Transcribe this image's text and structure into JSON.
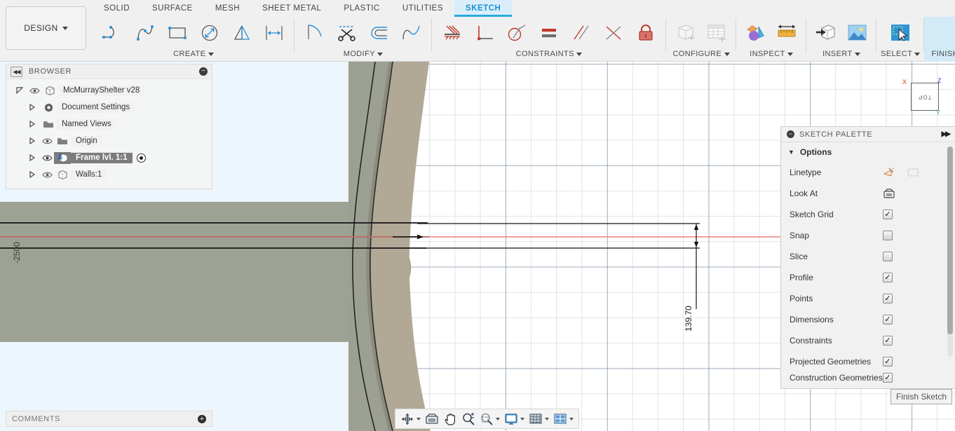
{
  "app": {
    "product_menu": "DESIGN"
  },
  "tabs": [
    {
      "label": "SOLID",
      "active": false
    },
    {
      "label": "SURFACE",
      "active": false
    },
    {
      "label": "MESH",
      "active": false
    },
    {
      "label": "SHEET METAL",
      "active": false
    },
    {
      "label": "PLASTIC",
      "active": false
    },
    {
      "label": "UTILITIES",
      "active": false
    },
    {
      "label": "SKETCH",
      "active": true
    }
  ],
  "ribbon": {
    "groups": [
      {
        "label": "CREATE",
        "tools": [
          {
            "icon": "line-icon",
            "name": "line-tool"
          },
          {
            "icon": "spline-icon",
            "name": "spline-tool"
          },
          {
            "icon": "rectangle-icon",
            "name": "rectangle-tool"
          },
          {
            "icon": "circle-icon",
            "name": "circle-tool"
          },
          {
            "icon": "mirror-icon",
            "name": "mirror-tool"
          },
          {
            "icon": "sketch-dimension-icon",
            "name": "sketch-dimension-tool"
          }
        ]
      },
      {
        "label": "MODIFY",
        "tools": [
          {
            "icon": "fillet-icon",
            "name": "fillet-tool"
          },
          {
            "icon": "trim-scissors-icon",
            "name": "trim-tool"
          },
          {
            "icon": "offset-icon",
            "name": "offset-tool"
          },
          {
            "icon": "break-curve-icon",
            "name": "break-tool"
          }
        ]
      },
      {
        "label": "CONSTRAINTS",
        "tools": [
          {
            "icon": "coincident-icon",
            "name": "coincident-constraint"
          },
          {
            "icon": "perpendicular-icon",
            "name": "perpendicular-constraint"
          },
          {
            "icon": "tangent-icon",
            "name": "tangent-constraint"
          },
          {
            "icon": "equal-icon",
            "name": "equal-constraint"
          },
          {
            "icon": "parallel-icon",
            "name": "parallel-constraint"
          },
          {
            "icon": "midpoint-icon",
            "name": "midpoint-constraint"
          },
          {
            "icon": "fix-unfix-lock-icon",
            "name": "fix-unfix-constraint"
          }
        ]
      },
      {
        "label": "CONFIGURE",
        "tools": [
          {
            "icon": "configure-part-icon",
            "name": "configure-part-tool"
          },
          {
            "icon": "configure-table-icon",
            "name": "configure-table-tool"
          }
        ]
      },
      {
        "label": "INSPECT",
        "tools": [
          {
            "icon": "section-analysis-icon",
            "name": "section-analysis-tool"
          },
          {
            "icon": "measure-ruler-icon",
            "name": "measure-tool"
          }
        ]
      },
      {
        "label": "INSERT",
        "tools": [
          {
            "icon": "insert-derive-icon",
            "name": "insert-derive-tool"
          },
          {
            "icon": "insert-canvas-image-icon",
            "name": "insert-canvas-tool"
          }
        ]
      },
      {
        "label": "SELECT",
        "tools": [
          {
            "icon": "select-cursor-icon",
            "name": "select-tool"
          }
        ]
      },
      {
        "label": "FINISH SKETCH",
        "tools": [
          {
            "icon": "green-check-icon",
            "name": "finish-sketch-tool"
          }
        ]
      }
    ]
  },
  "browser": {
    "title": "BROWSER",
    "nodes": [
      {
        "label": "McMurrayShelter v28",
        "icon": "document-body-icon",
        "expanded": true,
        "eye": true,
        "arrow": "open",
        "selected": false,
        "radio": false
      },
      {
        "label": "Document Settings",
        "icon": "gear-icon",
        "expanded": false,
        "eye": false,
        "arrow": "closed",
        "selected": false,
        "radio": false
      },
      {
        "label": "Named Views",
        "icon": "folder-icon",
        "expanded": false,
        "eye": false,
        "arrow": "closed",
        "selected": false,
        "radio": false
      },
      {
        "label": "Origin",
        "icon": "folder-icon",
        "expanded": false,
        "eye": true,
        "arrow": "closed",
        "selected": false,
        "radio": false
      },
      {
        "label": "Frame lvl. 1:1",
        "icon": "component-anchor-icon",
        "expanded": false,
        "eye": true,
        "arrow": "closed",
        "selected": true,
        "radio": true
      },
      {
        "label": "Walls:1",
        "icon": "component-icon",
        "expanded": false,
        "eye": true,
        "arrow": "closed",
        "selected": false,
        "radio": false
      }
    ]
  },
  "comments": {
    "title": "COMMENTS",
    "add_icon": "plus-icon"
  },
  "palette": {
    "title": "SKETCH PALETTE",
    "section": "Options",
    "rows": [
      {
        "label": "Linetype",
        "control": "icon-pair",
        "icons": [
          "linetype-normal-icon",
          "linetype-construction-icon"
        ]
      },
      {
        "label": "Look At",
        "control": "icon",
        "icons": [
          "look-at-icon"
        ]
      },
      {
        "label": "Sketch Grid",
        "control": "checkbox",
        "checked": true
      },
      {
        "label": "Snap",
        "control": "checkbox",
        "checked": false
      },
      {
        "label": "Slice",
        "control": "checkbox",
        "checked": false
      },
      {
        "label": "Profile",
        "control": "checkbox",
        "checked": true
      },
      {
        "label": "Points",
        "control": "checkbox",
        "checked": true
      },
      {
        "label": "Dimensions",
        "control": "checkbox",
        "checked": true
      },
      {
        "label": "Constraints",
        "control": "checkbox",
        "checked": true
      },
      {
        "label": "Projected Geometries",
        "control": "checkbox",
        "checked": true
      },
      {
        "label": "Construction Geometries",
        "control": "checkbox",
        "checked": true
      }
    ],
    "finish_button": "Finish Sketch"
  },
  "canvas": {
    "dimension_value": "139.70",
    "axis_label": "-2500",
    "viewcube": {
      "face": "TOP",
      "axis_x": "X",
      "axis_y": "Y",
      "axis_z": "Z"
    },
    "colors": {
      "sketch_plane_tint": "#eef6fd",
      "wall_fill": "#9ba093",
      "wall_outer_fill": "#b2a896",
      "x_axis": "#e8817c"
    }
  },
  "navbar": {
    "items": [
      {
        "icon": "orbit-icon",
        "name": "orbit-tool",
        "caret": true
      },
      {
        "icon": "look-at-camera-icon",
        "name": "look-at-tool",
        "caret": false
      },
      {
        "icon": "pan-hand-icon",
        "name": "pan-tool",
        "caret": false
      },
      {
        "icon": "zoom-magnifier-icon",
        "name": "zoom-tool",
        "caret": false
      },
      {
        "icon": "zoom-window-icon",
        "name": "zoom-window-tool",
        "caret": true
      },
      {
        "icon": "display-settings-icon",
        "name": "display-settings",
        "caret": true
      },
      {
        "icon": "grid-snaps-icon",
        "name": "grid-and-snaps",
        "caret": true
      },
      {
        "icon": "viewports-icon",
        "name": "viewports",
        "caret": true
      }
    ]
  }
}
